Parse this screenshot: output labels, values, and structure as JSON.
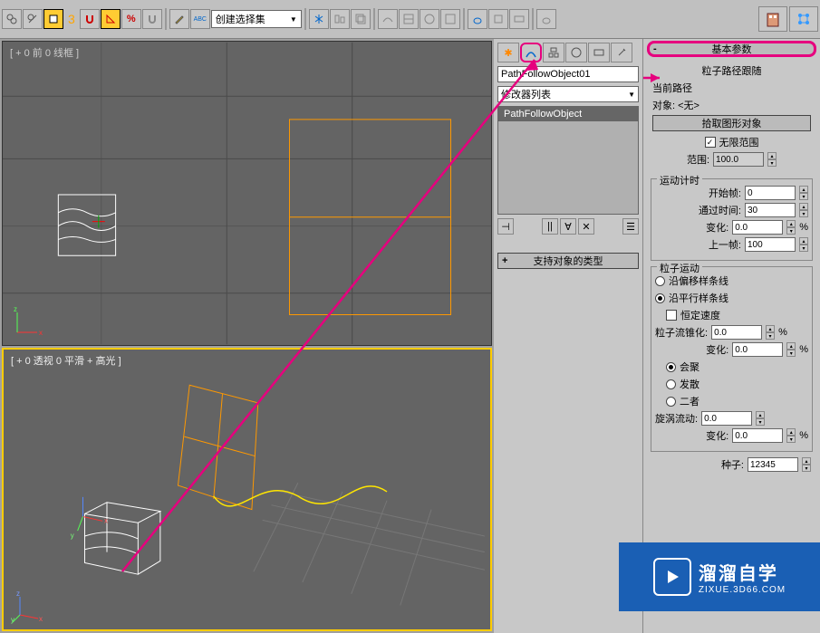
{
  "toolbar": {
    "number": "3",
    "dropdown_label": "创建选择集",
    "icons": [
      "link-icon",
      "unlink-icon",
      "select-icon",
      "num",
      "magnet-icon",
      "angle-icon",
      "percent-icon",
      "pencil-icon",
      "dropdown",
      "paste-icon",
      "mirror-icon",
      "align-icon",
      "array-icon",
      "layer-icon",
      "snap-icon",
      "copy-icon",
      "ortho-icon",
      "sep"
    ],
    "right_icons": [
      "building-icon",
      "graph-icon"
    ]
  },
  "viewport": {
    "front_label": "[ + 0 前 0 线框 ]",
    "persp_label": "[ + 0 透视 0 平滑 + 高光 ]"
  },
  "command_panel": {
    "object_name": "PathFollowObject01",
    "modifier_dropdown": "修改器列表",
    "modifier_stack_item": "PathFollowObject",
    "supported_types": "支持对象的类型"
  },
  "basic_params": {
    "header": "基本参数",
    "path_follow_label": "粒子路径跟随",
    "current_path_label": "当前路径",
    "object_label": "对象: <无>",
    "pick_button": "拾取图形对象",
    "infinite_range_label": "无限范围",
    "range_label": "范围:",
    "range_value": "100.0"
  },
  "motion_timer": {
    "group_title": "运动计时",
    "start_frame_label": "开始帧:",
    "start_frame": "0",
    "pass_time_label": "通过时间:",
    "pass_time": "30",
    "variation1_label": "变化:",
    "variation1": "0.0",
    "last_frame_label": "上一帧:",
    "last_frame": "100"
  },
  "particle_motion": {
    "group_title": "粒子运动",
    "along_offset_spline": "沿偏移样条线",
    "along_parallel_spline": "沿平行样条线",
    "constant_speed": "恒定速度",
    "stream_taper_label": "粒子流锥化:",
    "stream_taper": "0.0",
    "variation2_label": "变化:",
    "variation2": "0.0",
    "converge": "会聚",
    "diverge": "发散",
    "both": "二者",
    "swirl_label": "旋涡流动:",
    "swirl": "0.0",
    "variation3_label": "变化:",
    "variation3": "0.0"
  },
  "seed": {
    "label": "种子:",
    "value": "12345"
  },
  "watermark": {
    "main": "溜溜自学",
    "sub": "ZIXUE.3D66.COM"
  }
}
